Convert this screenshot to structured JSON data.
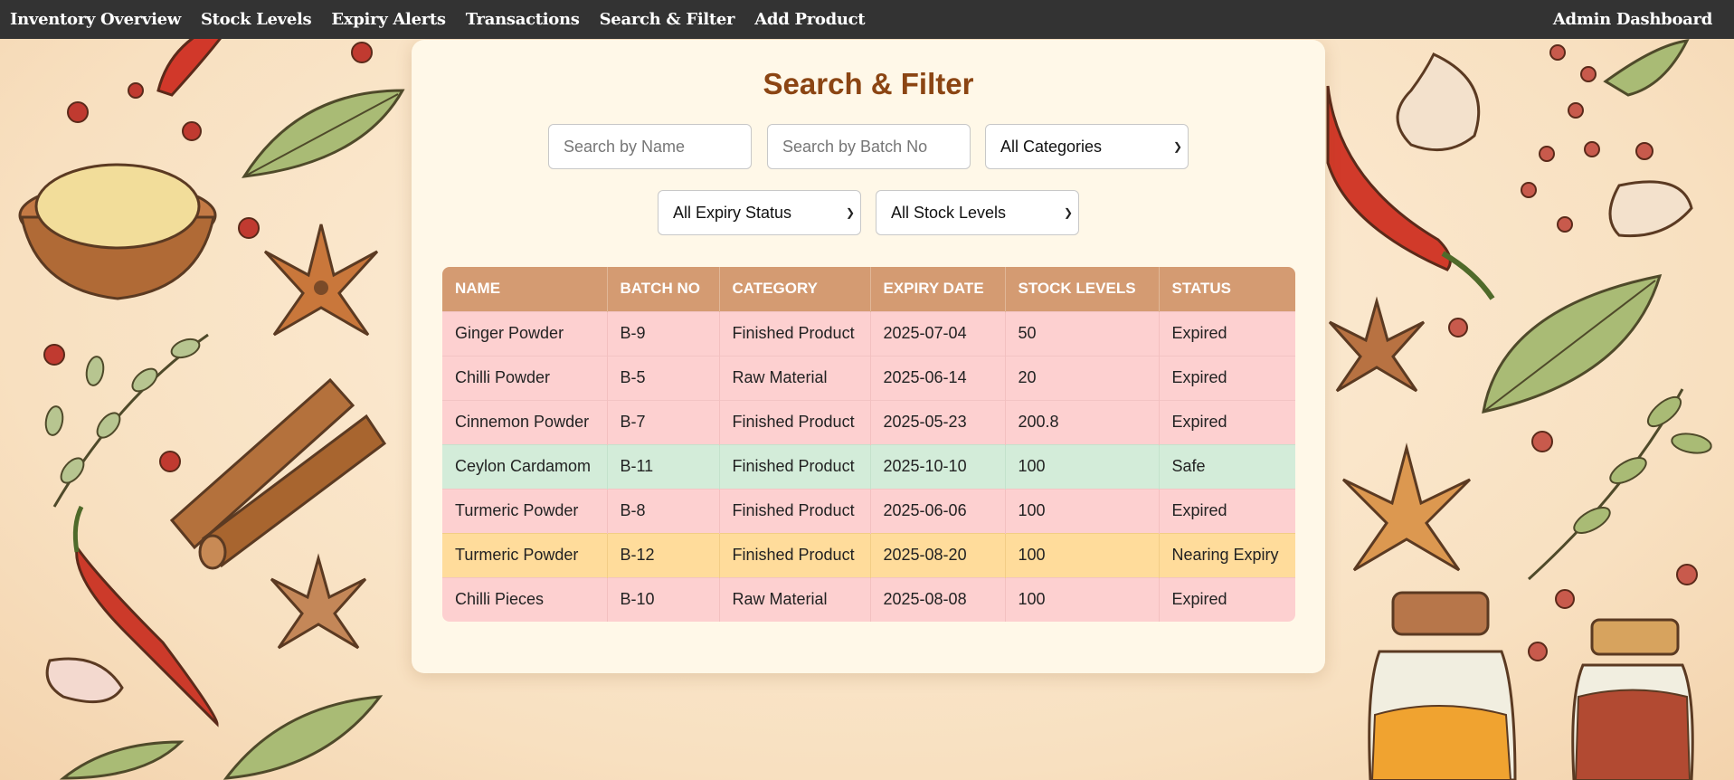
{
  "nav": {
    "links": [
      "Inventory Overview",
      "Stock Levels",
      "Expiry Alerts",
      "Transactions",
      "Search & Filter",
      "Add Product"
    ],
    "right": "Admin Dashboard"
  },
  "page": {
    "title": "Search & Filter"
  },
  "filters": {
    "name_placeholder": "Search by Name",
    "batch_placeholder": "Search by Batch No",
    "category_selected": "All Categories",
    "expiry_selected": "All Expiry Status",
    "stock_selected": "All Stock Levels"
  },
  "table": {
    "headers": [
      "NAME",
      "BATCH NO",
      "CATEGORY",
      "EXPIRY DATE",
      "STOCK LEVELS",
      "STATUS"
    ],
    "rows": [
      {
        "name": "Ginger Powder",
        "batch": "B-9",
        "category": "Finished Product",
        "expiry": "2025-07-04",
        "stock": "50",
        "status": "Expired",
        "status_key": "expired"
      },
      {
        "name": "Chilli Powder",
        "batch": "B-5",
        "category": "Raw Material",
        "expiry": "2025-06-14",
        "stock": "20",
        "status": "Expired",
        "status_key": "expired"
      },
      {
        "name": "Cinnemon Powder",
        "batch": "B-7",
        "category": "Finished Product",
        "expiry": "2025-05-23",
        "stock": "200.8",
        "status": "Expired",
        "status_key": "expired"
      },
      {
        "name": "Ceylon Cardamom",
        "batch": "B-11",
        "category": "Finished Product",
        "expiry": "2025-10-10",
        "stock": "100",
        "status": "Safe",
        "status_key": "safe"
      },
      {
        "name": "Turmeric Powder",
        "batch": "B-8",
        "category": "Finished Product",
        "expiry": "2025-06-06",
        "stock": "100",
        "status": "Expired",
        "status_key": "expired"
      },
      {
        "name": "Turmeric Powder",
        "batch": "B-12",
        "category": "Finished Product",
        "expiry": "2025-08-20",
        "stock": "100",
        "status": "Nearing Expiry",
        "status_key": "nearing"
      },
      {
        "name": "Chilli Pieces",
        "batch": "B-10",
        "category": "Raw Material",
        "expiry": "2025-08-08",
        "stock": "100",
        "status": "Expired",
        "status_key": "expired"
      }
    ]
  },
  "colors": {
    "navbar": "#333333",
    "title": "#8b4513",
    "table_header": "#d49b72",
    "expired_row": "#fdd0d0",
    "safe_row": "#d3ecd9",
    "nearing_row": "#ffdc9b"
  },
  "background_illustrations": [
    "chili-pepper-icon",
    "bay-leaf-icon",
    "star-anise-icon",
    "cinnamon-stick-icon",
    "garlic-clove-icon",
    "peppercorn-icon",
    "spice-bowl-icon",
    "spice-jar-icon"
  ]
}
